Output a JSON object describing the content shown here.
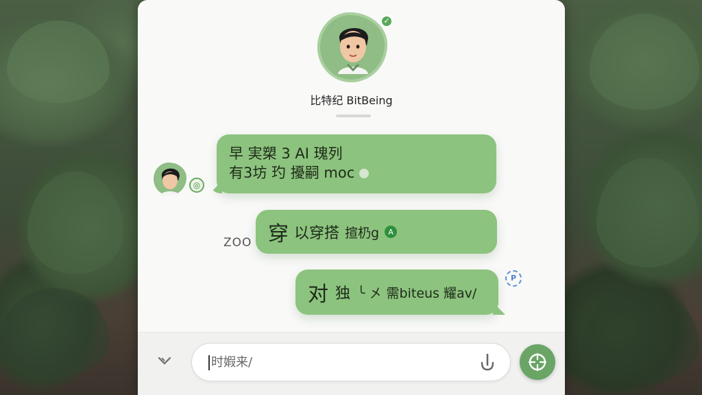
{
  "bot": {
    "name": "比特纪 BitBeing",
    "verified_icon": "check-icon"
  },
  "messages": [
    {
      "sender": "bot",
      "lines": [
        "早 実槊 3 AI 瑰列",
        "有3坊 玓 擾嗣 moc"
      ]
    },
    {
      "sender": "user",
      "parts": [
        "穿",
        "以穿搭",
        "揎㭁g"
      ],
      "side_label": "ZOO"
    },
    {
      "sender": "user",
      "parts": [
        "对",
        "独",
        "╰ 㐅 需biteus 耀av/"
      ]
    }
  ],
  "input": {
    "placeholder": "时婽来/",
    "value": ""
  },
  "icons": {
    "down": "chevron-down-icon",
    "mic": "microphone-icon",
    "send": "send-icon",
    "side": "p-badge-icon"
  },
  "colors": {
    "bubble": "#8cc37e",
    "accent": "#6aa566",
    "panel": "#f9f9f8"
  }
}
